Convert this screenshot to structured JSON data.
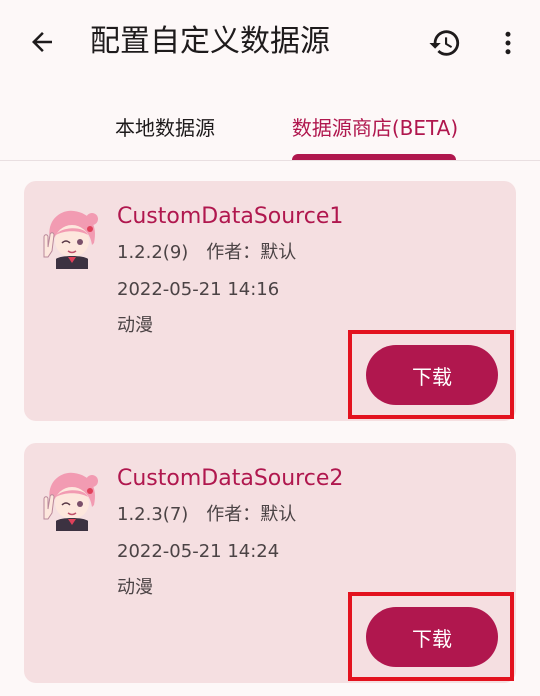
{
  "appbar": {
    "title": "配置自定义数据源",
    "back_icon": "arrow-back-icon",
    "history_icon": "history-icon",
    "more_icon": "more-vert-icon"
  },
  "tabs": [
    {
      "label": "本地数据源",
      "selected": false
    },
    {
      "label": "数据源商店(BETA)",
      "selected": true
    }
  ],
  "colors": {
    "accent": "#b0174e",
    "card_background": "#f5dfe1",
    "page_background": "#fdf8f8",
    "highlight": "#e3121e"
  },
  "sources": [
    {
      "name": "CustomDataSource1",
      "version": "1.2.2(9)",
      "author": "作者：默认",
      "date": "2022-05-21 14:16",
      "tag": "动漫",
      "button_label": "下载"
    },
    {
      "name": "CustomDataSource2",
      "version": "1.2.3(7)",
      "author": "作者：默认",
      "date": "2022-05-21 14:24",
      "tag": "动漫",
      "button_label": "下载"
    }
  ]
}
